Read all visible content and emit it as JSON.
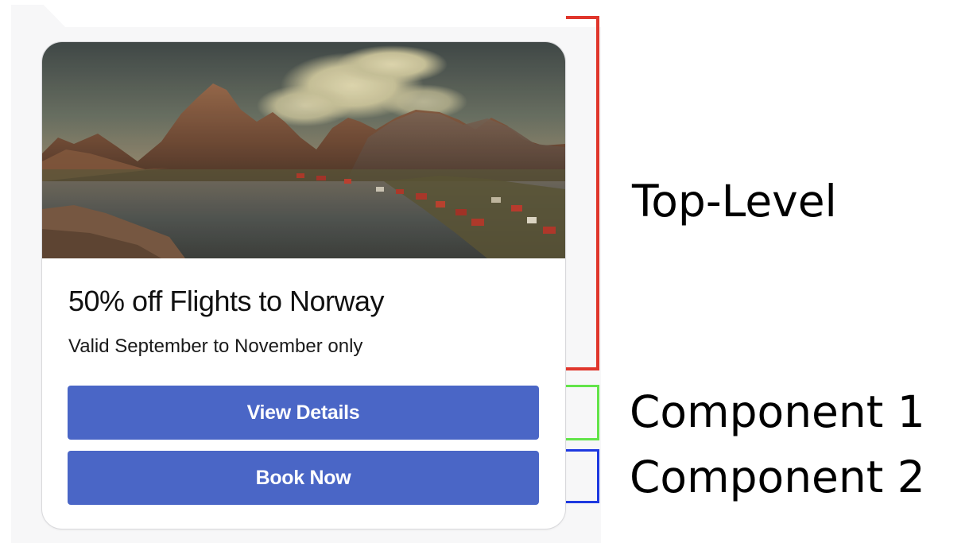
{
  "card": {
    "image_alt": "Mountains and a lakeside village in Norway",
    "title": "50% off Flights to Norway",
    "subtitle": "Valid September to November only",
    "buttons": {
      "view_details": "View Details",
      "book_now": "Book Now"
    },
    "button_color": "#4a66c6"
  },
  "annotations": {
    "top_level": {
      "label": "Top-Level",
      "color": "#e0362c"
    },
    "component_1": {
      "label": "Component 1",
      "color": "#63e44a"
    },
    "component_2": {
      "label": "Component 2",
      "color": "#1e39e0"
    }
  }
}
